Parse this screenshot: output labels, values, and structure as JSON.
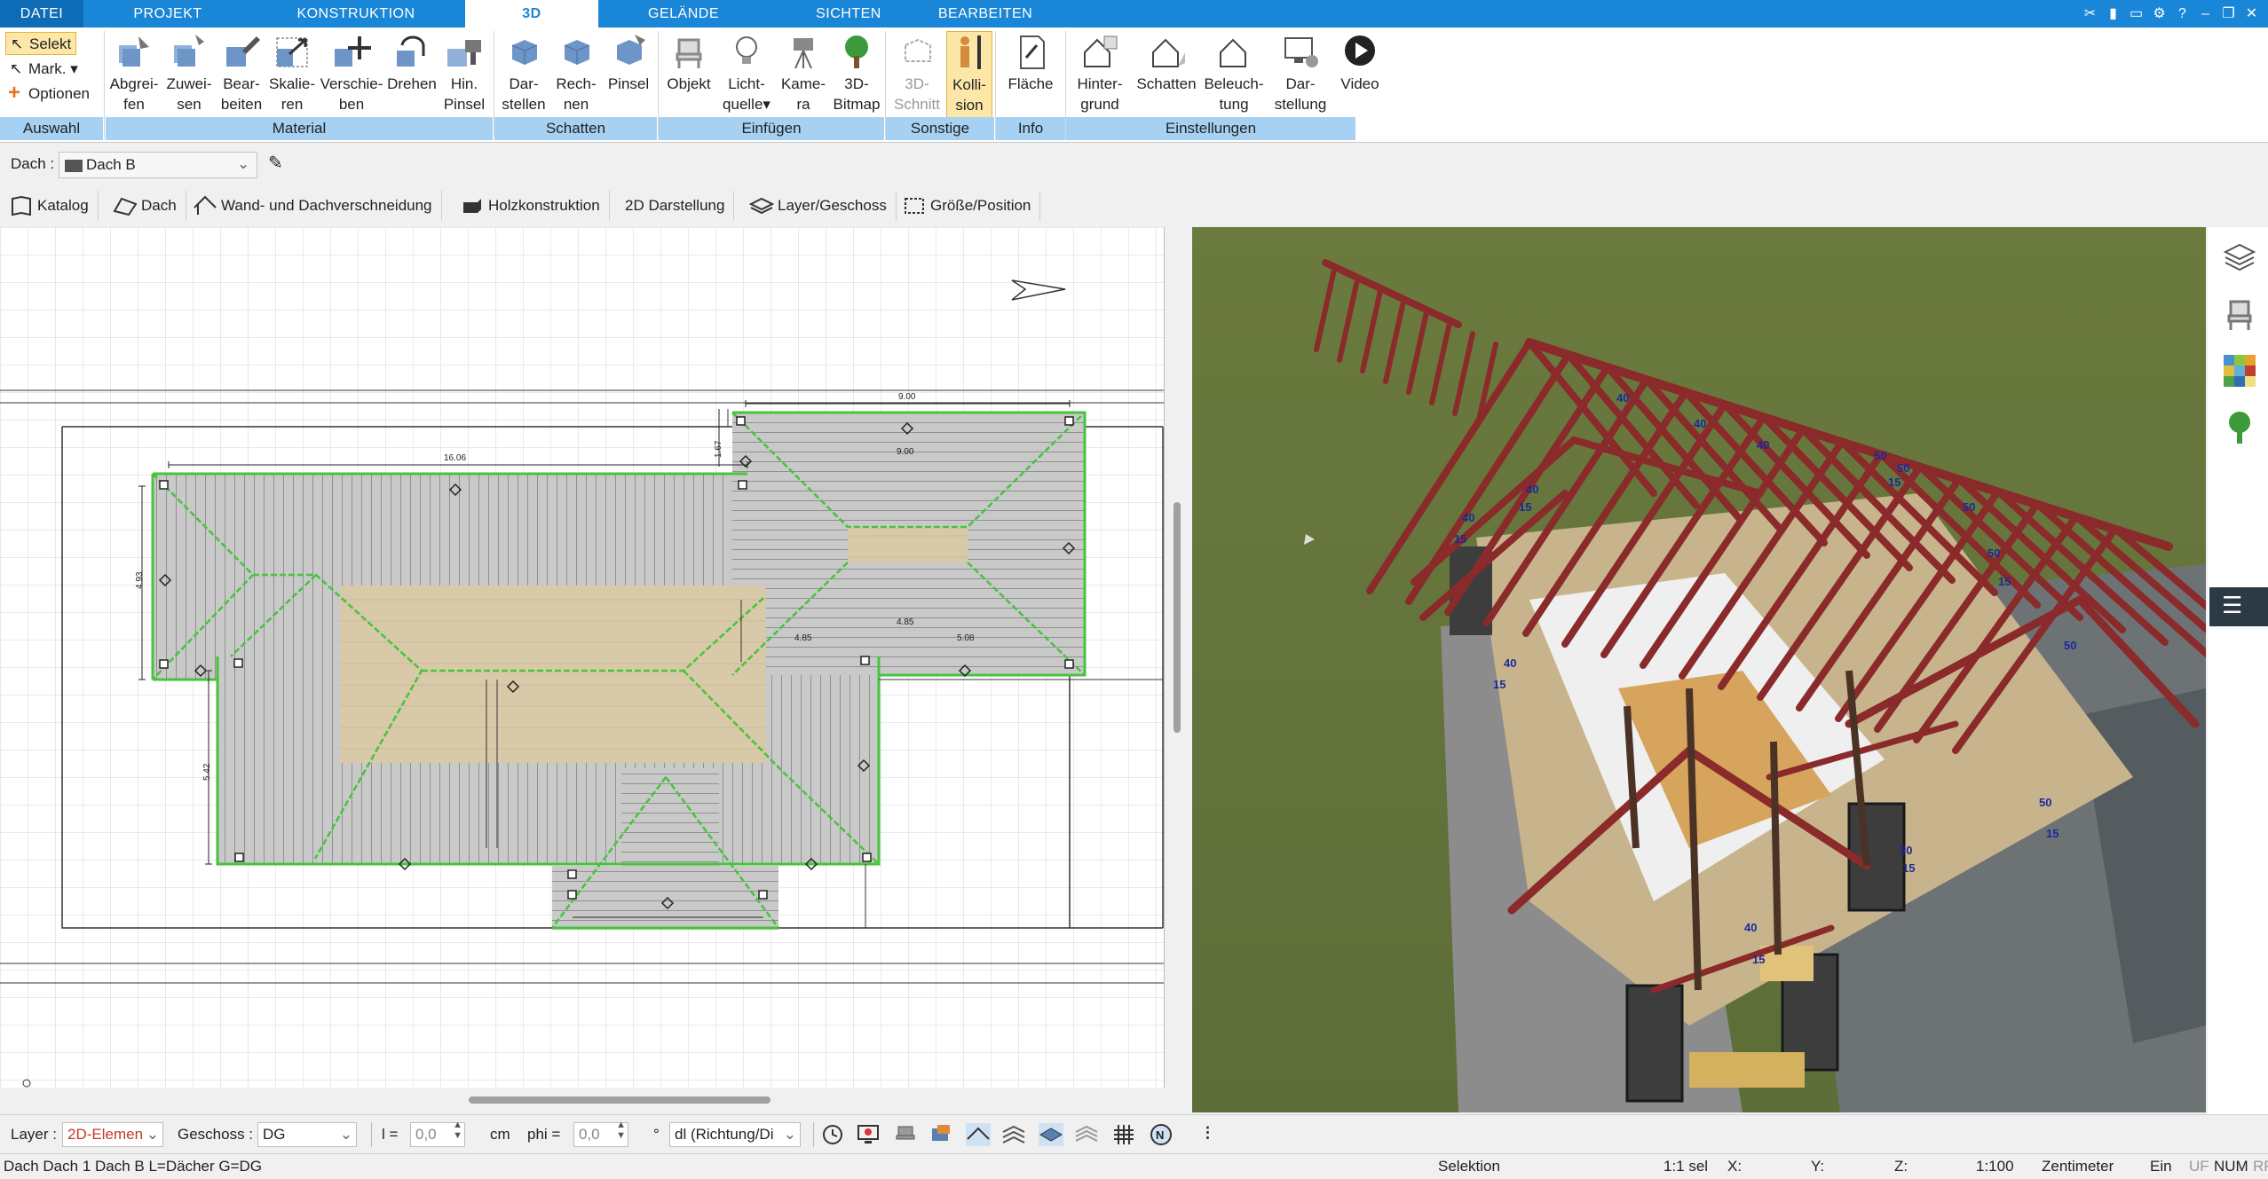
{
  "tabs": {
    "file": "DATEI",
    "project": "PROJEKT",
    "construction": "KONSTRUKTION",
    "threed": "3D",
    "terrain": "GELÄNDE",
    "views": "SICHTEN",
    "edit": "BEARBEITEN"
  },
  "selection": {
    "select": "Selekt",
    "mark": "Mark.",
    "options": "Optionen",
    "group": "Auswahl"
  },
  "ribbon": {
    "material": {
      "group": "Material",
      "pick_l1": "Abgrei-",
      "pick_l2": "fen",
      "assign_l1": "Zuwei-",
      "assign_l2": "sen",
      "edit_l1": "Bear-",
      "edit_l2": "beiten",
      "scale_l1": "Skalie-",
      "scale_l2": "ren",
      "move_l1": "Verschie-",
      "move_l2": "ben",
      "rotate_l1": "Drehen",
      "brush_l1": "Hin.",
      "brush_l2": "Pinsel"
    },
    "shadow": {
      "group": "Schatten",
      "show_l1": "Dar-",
      "show_l2": "stellen",
      "calc_l1": "Rech-",
      "calc_l2": "nen",
      "brush_l1": "Pinsel"
    },
    "insert": {
      "group": "Einfügen",
      "object": "Objekt",
      "light_l1": "Licht-",
      "light_l2": "quelle",
      "camera_l1": "Kame-",
      "camera_l2": "ra",
      "bitmap_l1": "3D-",
      "bitmap_l2": "Bitmap"
    },
    "other": {
      "group": "Sonstige",
      "cut_l1": "3D-",
      "cut_l2": "Schnitt",
      "collision_l1": "Kolli-",
      "collision_l2": "sion"
    },
    "info": {
      "group": "Info",
      "area": "Fläche"
    },
    "settings": {
      "group": "Einstellungen",
      "background_l1": "Hinter-",
      "background_l2": "grund",
      "shadows": "Schatten",
      "lighting_l1": "Beleuch-",
      "lighting_l2": "tung",
      "display_l1": "Dar-",
      "display_l2": "stellung",
      "video": "Video"
    }
  },
  "object_selector": {
    "label": "Dach :",
    "value": "Dach B"
  },
  "toolbar": {
    "catalog": "Katalog",
    "roof": "Dach",
    "wall_roof_cut": "Wand- und Dachverschneidung",
    "timber": "Holzkonstruktion",
    "display2d": "2D Darstellung",
    "layer": "Layer/Geschoss",
    "size": "Größe/Position"
  },
  "plan": {
    "dim_top_right": "9.00",
    "dim_top_main": "16.06",
    "dim_left": "4.93",
    "dim_left2": "5.42",
    "dim_small": "1.67",
    "dim_width": "9.00",
    "dim_a": "4.85",
    "dim_b": "5.08",
    "dim_c": "4.85"
  },
  "scene3d": {
    "labels_40": "40",
    "labels_15": "15",
    "labels_50": "50"
  },
  "properties": {
    "layer_label": "Layer :",
    "layer_value": "2D-Elemen",
    "floor_label": "Geschoss :",
    "floor_value": "DG",
    "l_label": "l =",
    "l_value": "0,0",
    "l_unit": "cm",
    "phi_label": "phi =",
    "phi_value": "0,0",
    "phi_unit": "°",
    "direction": "dl (Richtung/Di"
  },
  "status": {
    "info": "Dach Dach 1 Dach B L=Dächer G=DG",
    "mode": "Selektion",
    "sel": "1:1 sel",
    "x": "X:",
    "y": "Y:",
    "z": "Z:",
    "scale": "1:100",
    "unit": "Zentimeter",
    "ein": "Ein",
    "uf": "UF",
    "num": "NUM",
    "rf": "RF"
  },
  "colors": {
    "accent": "#1a86d8",
    "group_bar": "#a7d1f3",
    "rafter": "#8a2a2a",
    "grass": "#5f6d3a",
    "roof_ridge": "#46c43c"
  }
}
